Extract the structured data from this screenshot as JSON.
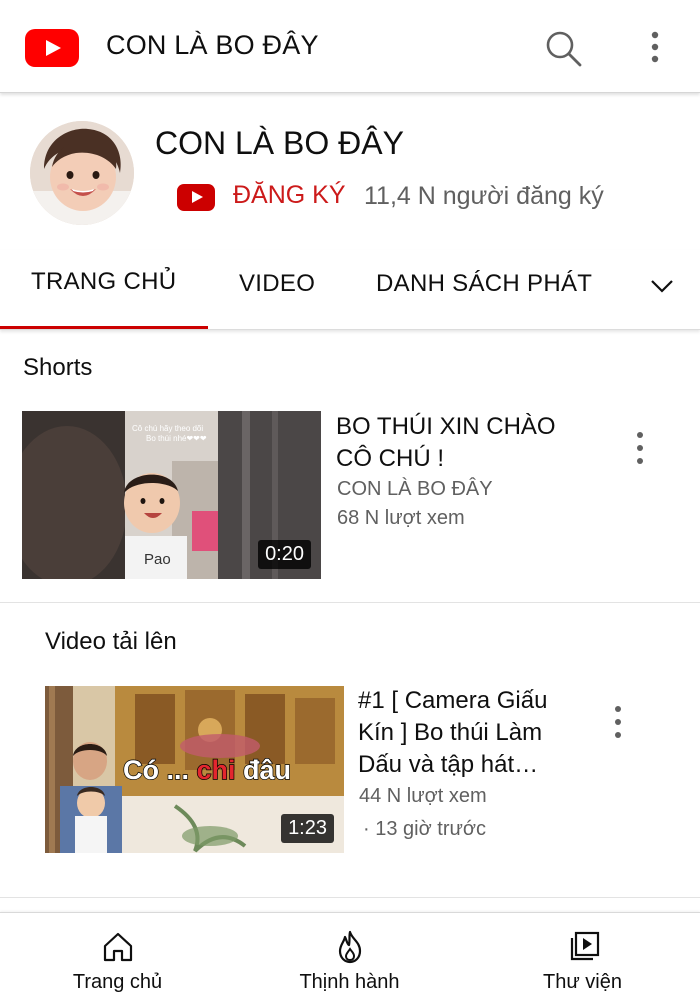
{
  "appbar": {
    "title": "CON LÀ BO ĐÂY",
    "icons": [
      "youtube-logo-icon",
      "search-icon",
      "more-vert-icon"
    ],
    "brand_color": "#ff0000"
  },
  "channel": {
    "name": "CON LÀ BO ĐÂY",
    "subscribe_label": "ĐĂNG KÝ",
    "subscriber_count": "11,4 N người đăng ký",
    "accent_color": "#cc0000"
  },
  "tabs": [
    {
      "label": "TRANG CHỦ",
      "selected": true
    },
    {
      "label": "VIDEO",
      "selected": false
    },
    {
      "label": "DANH SÁCH PHÁT",
      "selected": false
    }
  ],
  "shorts": {
    "section_title": "Shorts",
    "item": {
      "title_line1": "BO THÚI XIN CHÀO",
      "title_line2": "CÔ CHÚ !",
      "channel": "CON LÀ BO ĐÂY",
      "views": "68 N lượt xem",
      "duration": "0:20",
      "thumb_caption_line1": "Cô chú hãy theo dõi",
      "thumb_caption_line2": "Bo thúi nhé❤❤❤"
    }
  },
  "uploads": {
    "section_title": "Video tải lên",
    "item": {
      "title_line1": "#1 [ Camera Giấu",
      "title_line2": "Kín ] Bo thúi Làm",
      "title_line3": "Dấu và tập hát…",
      "views": "44 N lượt xem",
      "age": "· 13 giờ trước",
      "duration": "1:23",
      "thumb_text_a": "Có ... ",
      "thumb_text_b": "chi",
      "thumb_text_c": " đâu"
    }
  },
  "bottom_nav": [
    {
      "label": "Trang chủ",
      "icon": "home-icon"
    },
    {
      "label": "Thịnh hành",
      "icon": "trending-flame-icon"
    },
    {
      "label": "Thư viện",
      "icon": "library-icon"
    }
  ]
}
